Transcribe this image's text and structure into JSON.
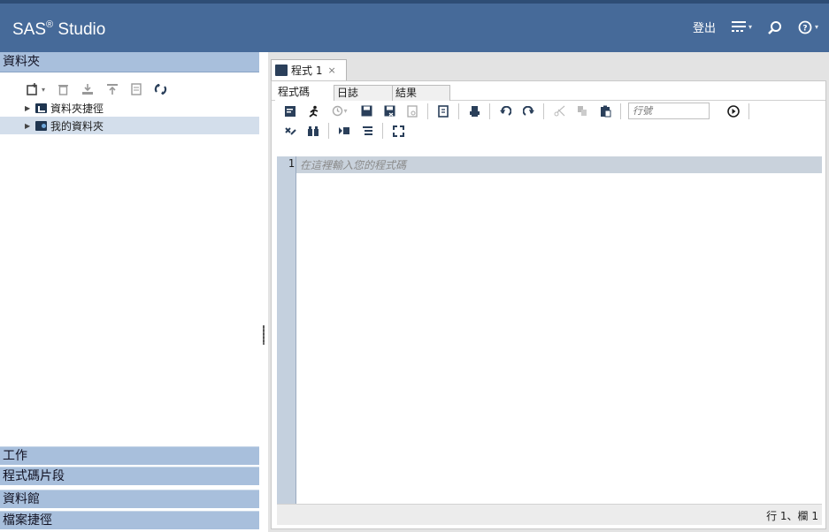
{
  "header": {
    "brand": "SAS",
    "brand_sup": "®",
    "brand_suffix": " Studio",
    "signout": "登出",
    "icons": [
      "menu-icon",
      "search-icon",
      "help-icon"
    ],
    "bg_color": "#466a99"
  },
  "left_pane": {
    "title": "資料夾",
    "toolbar_icons": [
      "new-item-icon",
      "delete-icon",
      "download-icon",
      "upload-icon",
      "properties-icon",
      "refresh-icon"
    ],
    "tree": [
      {
        "label": "資料夾捷徑",
        "icon": "folder-shortcut-icon",
        "selected": false
      },
      {
        "label": "我的資料夾",
        "icon": "my-folder-icon",
        "selected": true
      }
    ],
    "accordion": [
      "工作",
      "程式碼片段",
      "資料館",
      "檔案捷徑"
    ]
  },
  "editor": {
    "tab": {
      "label": "程式 1",
      "close": "×"
    },
    "subtabs": [
      "程式碼",
      "日誌",
      "結果"
    ],
    "active_subtab": "程式碼",
    "line_input_placeholder": "行號",
    "line_numbers": [
      "1"
    ],
    "placeholder": "在這裡輸入您的程式碼",
    "status": "行 1、欄 1"
  }
}
